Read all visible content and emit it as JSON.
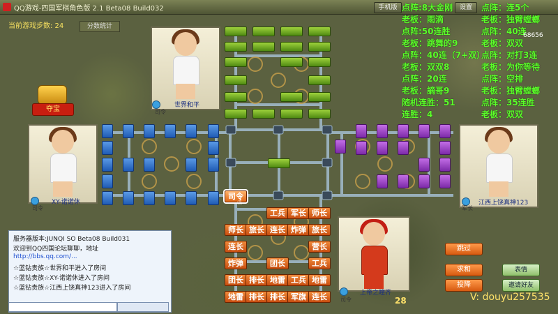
{
  "window": {
    "title": "QQ游戏-四国军棋角色版 2.1 Beta08 Build032",
    "buttons": [
      "手机版",
      "设置"
    ]
  },
  "header": {
    "move_count": "当前游戏步数: 24",
    "score_stats_label": "分数统计"
  },
  "players": {
    "top": {
      "name": "世界和平",
      "rank": "司令"
    },
    "left": {
      "name": "XY-诺诺休",
      "rank": "司令"
    },
    "right": {
      "name": "江西上饶真神123",
      "rank": "军长"
    },
    "bottom": {
      "name": "上帝之瞳齐",
      "rank": "司令"
    }
  },
  "treasure_label": "夺宝",
  "right_log": {
    "col1": [
      "点阵:8大金刚",
      "老板：雨滴",
      "点阵:50连胜",
      "老板：跳舞的9",
      "点阵：40连（7+双）",
      "老板：双双8",
      "点阵：20连",
      "老板：謫哥9",
      "随机连胜：51",
      "连胜：4"
    ],
    "col2": [
      "点阵：连5个",
      "老板：独臂螳螂",
      "点阵：40连",
      "老板：双双",
      "点阵：对打3连",
      "老板：为你等待",
      "点阵：空排",
      "老板：独臂螳螂",
      "点阵：35连胜",
      "老板：双双"
    ],
    "overlay_id": "68656"
  },
  "board": {
    "pieces": [
      {
        "label": "司令",
        "selected": true
      },
      {
        "label": "工兵"
      },
      {
        "label": "军长"
      },
      {
        "label": "师长"
      },
      {
        "label": "师长"
      },
      {
        "label": "旅长"
      },
      {
        "label": "连长"
      },
      {
        "label": "炸弹"
      },
      {
        "label": "旅长"
      },
      {
        "label": "连长"
      },
      {
        "label": "营长"
      },
      {
        "label": "炸弹"
      },
      {
        "label": "团长"
      },
      {
        "label": "工兵"
      },
      {
        "label": "团长"
      },
      {
        "label": "排长"
      },
      {
        "label": "地雷"
      },
      {
        "label": "工兵"
      },
      {
        "label": "地雷"
      },
      {
        "label": "地雷"
      },
      {
        "label": "排长"
      },
      {
        "label": "排长"
      },
      {
        "label": "军旗"
      },
      {
        "label": "连长"
      }
    ]
  },
  "chat": {
    "lines": [
      "服务器版本:JUNQI SO Beta08 Build031",
      "欢迎到QQ四国论坛聊聊，地址",
      "http://bbs.qq.com/...",
      "☆蓝钻贵族☆世界和平进入了房间",
      "☆蓝钻贵族☆XY-诺诺休进入了房间",
      "☆蓝钻贵族☆江西上饶真神123进入了房间"
    ],
    "input_placeholder": ""
  },
  "actions": {
    "skip": "跳过",
    "peace": "求和",
    "surrender": "投降",
    "emote": "表情",
    "invite": "邀请好友"
  },
  "counter": "28",
  "watermark": "V: douyu257535",
  "colors": {
    "green_army": "#6fae22",
    "blue_army": "#2f6fc8",
    "purple_army": "#9a3fc4",
    "orange_army": "#e26a22",
    "log_text": "#5cff2a"
  }
}
